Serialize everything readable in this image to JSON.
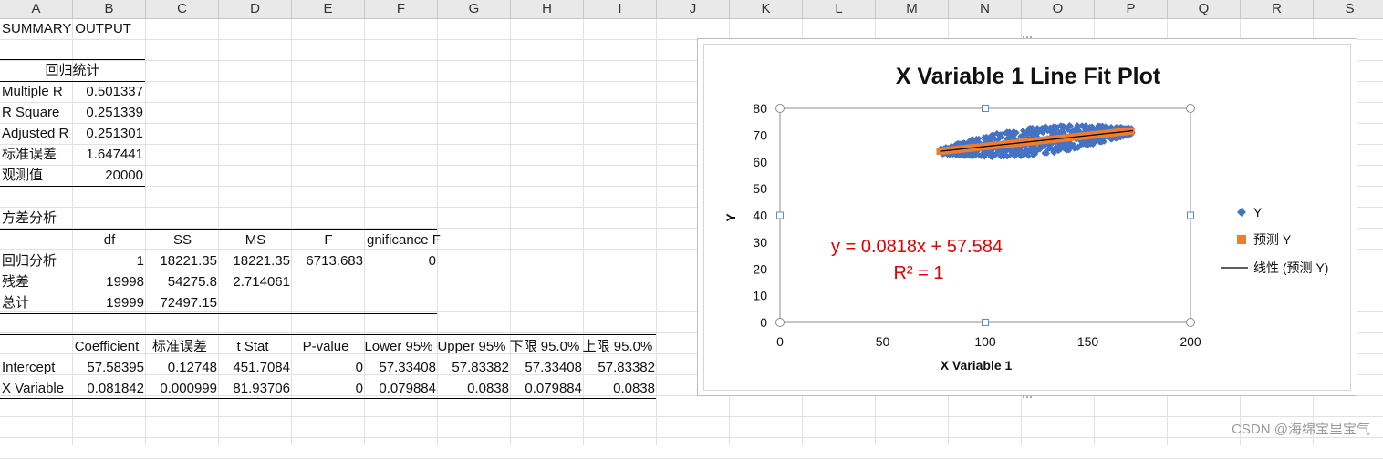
{
  "columns": [
    "A",
    "B",
    "C",
    "D",
    "E",
    "F",
    "G",
    "H",
    "I",
    "J",
    "K",
    "L",
    "M",
    "N",
    "O",
    "P",
    "Q",
    "R",
    "S"
  ],
  "summary": {
    "title": "SUMMARY OUTPUT",
    "regstats_header": "回归统计",
    "regstats": [
      {
        "label": "Multiple R",
        "value": "0.501337"
      },
      {
        "label": "R Square",
        "value": "0.251339"
      },
      {
        "label": "Adjusted R",
        "value": "0.251301"
      },
      {
        "label": "标准误差",
        "value": "1.647441"
      },
      {
        "label": "观测值",
        "value": "20000"
      }
    ],
    "anova_title": "方差分析",
    "anova_headers": [
      "df",
      "SS",
      "MS",
      "F",
      "gnificance F"
    ],
    "anova_rows": [
      {
        "label": "回归分析",
        "cells": [
          "1",
          "18221.35",
          "18221.35",
          "6713.683",
          "0"
        ]
      },
      {
        "label": "残差",
        "cells": [
          "19998",
          "54275.8",
          "2.714061",
          "",
          ""
        ]
      },
      {
        "label": "总计",
        "cells": [
          "19999",
          "72497.15",
          "",
          "",
          ""
        ]
      }
    ],
    "coef_headers": [
      "Coefficient",
      "标准误差",
      "t Stat",
      "P-value",
      "Lower 95%",
      "Upper 95%",
      "下限 95.0%",
      "上限 95.0%"
    ],
    "coef_rows": [
      {
        "label": "Intercept",
        "cells": [
          "57.58395",
          "0.12748",
          "451.7084",
          "0",
          "57.33408",
          "57.83382",
          "57.33408",
          "57.83382"
        ]
      },
      {
        "label": "X Variable",
        "cells": [
          "0.081842",
          "0.000999",
          "81.93706",
          "0",
          "0.079884",
          "0.0838",
          "0.079884",
          "0.0838"
        ]
      }
    ]
  },
  "chart": {
    "title": "X Variable 1 Line Fit  Plot",
    "xlabel": "X Variable 1",
    "ylabel": "Y",
    "equation": "y = 0.0818x + 57.584",
    "r2": "R² = 1",
    "legend": [
      "Y",
      "预测 Y",
      "线性 (预测 Y)"
    ],
    "colors": {
      "y": "#4472c4",
      "pred": "#ed7d31",
      "trend": "#000000",
      "annot": "#e00000"
    }
  },
  "chart_data": {
    "type": "scatter",
    "title": "X Variable 1 Line Fit  Plot",
    "xlabel": "X Variable 1",
    "ylabel": "Y",
    "xlim": [
      0,
      200
    ],
    "ylim": [
      0,
      80
    ],
    "xticks": [
      0,
      50,
      100,
      150,
      200
    ],
    "yticks": [
      0,
      10,
      20,
      30,
      40,
      50,
      60,
      70,
      80
    ],
    "legend_position": "right",
    "series": [
      {
        "name": "Y",
        "kind": "scatter-cloud",
        "x_range": [
          78,
          172
        ],
        "approx": "y ≈ 0.0818x + 57.584 ± 4"
      },
      {
        "name": "预测 Y",
        "kind": "scatter",
        "x": [
          78,
          90,
          100,
          110,
          120,
          130,
          140,
          150,
          160,
          172
        ],
        "y": [
          63.97,
          64.95,
          65.77,
          66.59,
          67.4,
          68.22,
          69.04,
          69.86,
          70.68,
          71.66
        ]
      },
      {
        "name": "线性 (预测 Y)",
        "kind": "trendline",
        "slope": 0.0818,
        "intercept": 57.584
      }
    ],
    "grid": false
  },
  "watermark": "CSDN @海绵宝里宝气"
}
